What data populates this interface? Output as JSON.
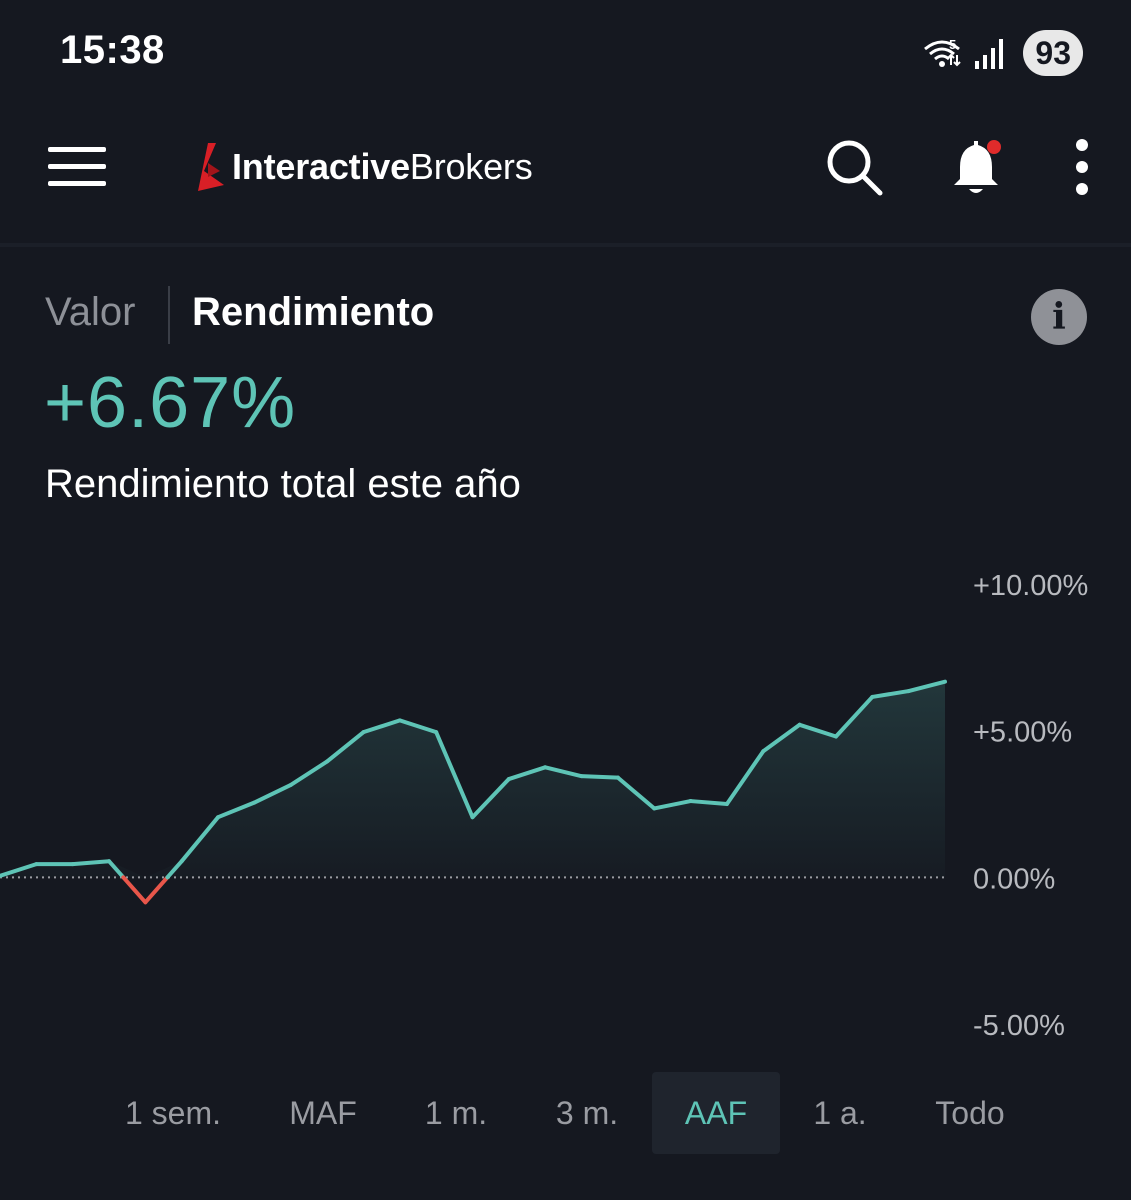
{
  "status_bar": {
    "time": "15:38",
    "network_badge": "5",
    "battery": "93"
  },
  "app_bar": {
    "logo_bold": "Interactive",
    "logo_regular": "Brokers"
  },
  "tabs": {
    "valor": "Valor",
    "rendimiento": "Rendimiento"
  },
  "summary": {
    "value": "+6.67%",
    "caption": "Rendimiento total este año"
  },
  "colors": {
    "positive": "#5ec4b6",
    "negative": "#e8564a",
    "background": "#151820"
  },
  "chart_data": {
    "type": "area",
    "y_ticks": [
      "+10.00%",
      "+5.00%",
      "0.00%",
      "-5.00%"
    ],
    "ylim": [
      -5,
      10
    ],
    "baseline": 0,
    "baseline_style": "dotted",
    "values": [
      0.05,
      0.45,
      0.45,
      0.55,
      -0.85,
      0.55,
      2.05,
      2.55,
      3.15,
      3.95,
      4.95,
      5.35,
      4.95,
      2.05,
      3.35,
      3.75,
      3.45,
      3.4,
      2.35,
      2.6,
      2.5,
      4.3,
      5.2,
      4.8,
      6.15,
      6.35,
      6.67
    ]
  },
  "range_selector": {
    "options": [
      "1 sem.",
      "MAF",
      "1 m.",
      "3 m.",
      "AAF",
      "1 a.",
      "Todo"
    ],
    "selected": "AAF"
  },
  "icons": {
    "menu": "hamburger-menu-icon",
    "search": "search-icon",
    "bell": "bell-icon",
    "more": "more-vertical-icon",
    "info": "info-icon"
  }
}
